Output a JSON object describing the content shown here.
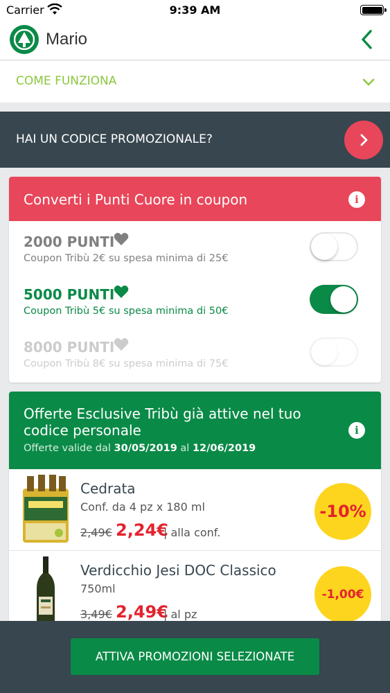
{
  "status_bar": {
    "carrier": "Carrier",
    "time": "9:39 AM"
  },
  "nav": {
    "title": "Mario"
  },
  "accordion": {
    "label": "COME FUNZIONA"
  },
  "promo_code": {
    "label": "HAI UN CODICE PROMOZIONALE?"
  },
  "convert": {
    "title": "Converti i Punti Cuore in coupon",
    "options": [
      {
        "points": "2000 PUNTI",
        "description": "Coupon Tribù 2€ su spesa minima di 25€",
        "state": "off"
      },
      {
        "points": "5000 PUNTI",
        "description": "Coupon Tribù 5€ su spesa minima di 50€",
        "state": "on"
      },
      {
        "points": "8000 PUNTI",
        "description": "Coupon Tribù 8€ su spesa minima di 75€",
        "state": "disabled"
      }
    ]
  },
  "offers": {
    "title": "Offerte Esclusive Tribù già attive nel tuo codice personale",
    "validity_prefix": "Offerte valide dal",
    "date_from": "30/05/2019",
    "validity_mid": "al",
    "date_to": "12/06/2019",
    "products": [
      {
        "name": "Cedrata",
        "size": "Conf. da 4 pz x 180 ml",
        "old_price": "2,49€",
        "price": "2,24€",
        "unit": "| alla conf.",
        "discount": "-10%"
      },
      {
        "name": "Verdicchio Jesi DOC Classico",
        "size": "750ml",
        "old_price": "3,49€",
        "price": "2,49€",
        "unit": "| al pz",
        "discount": "-1,00€"
      }
    ]
  },
  "footer": {
    "activate_label": "ATTIVA PROMOZIONI SELEZIONATE"
  },
  "colors": {
    "green": "#0a8a47",
    "red": "#e8465a",
    "dark": "#37464f",
    "lime": "#8cc63f",
    "yellow": "#fdd51e",
    "price_red": "#e3232e"
  }
}
